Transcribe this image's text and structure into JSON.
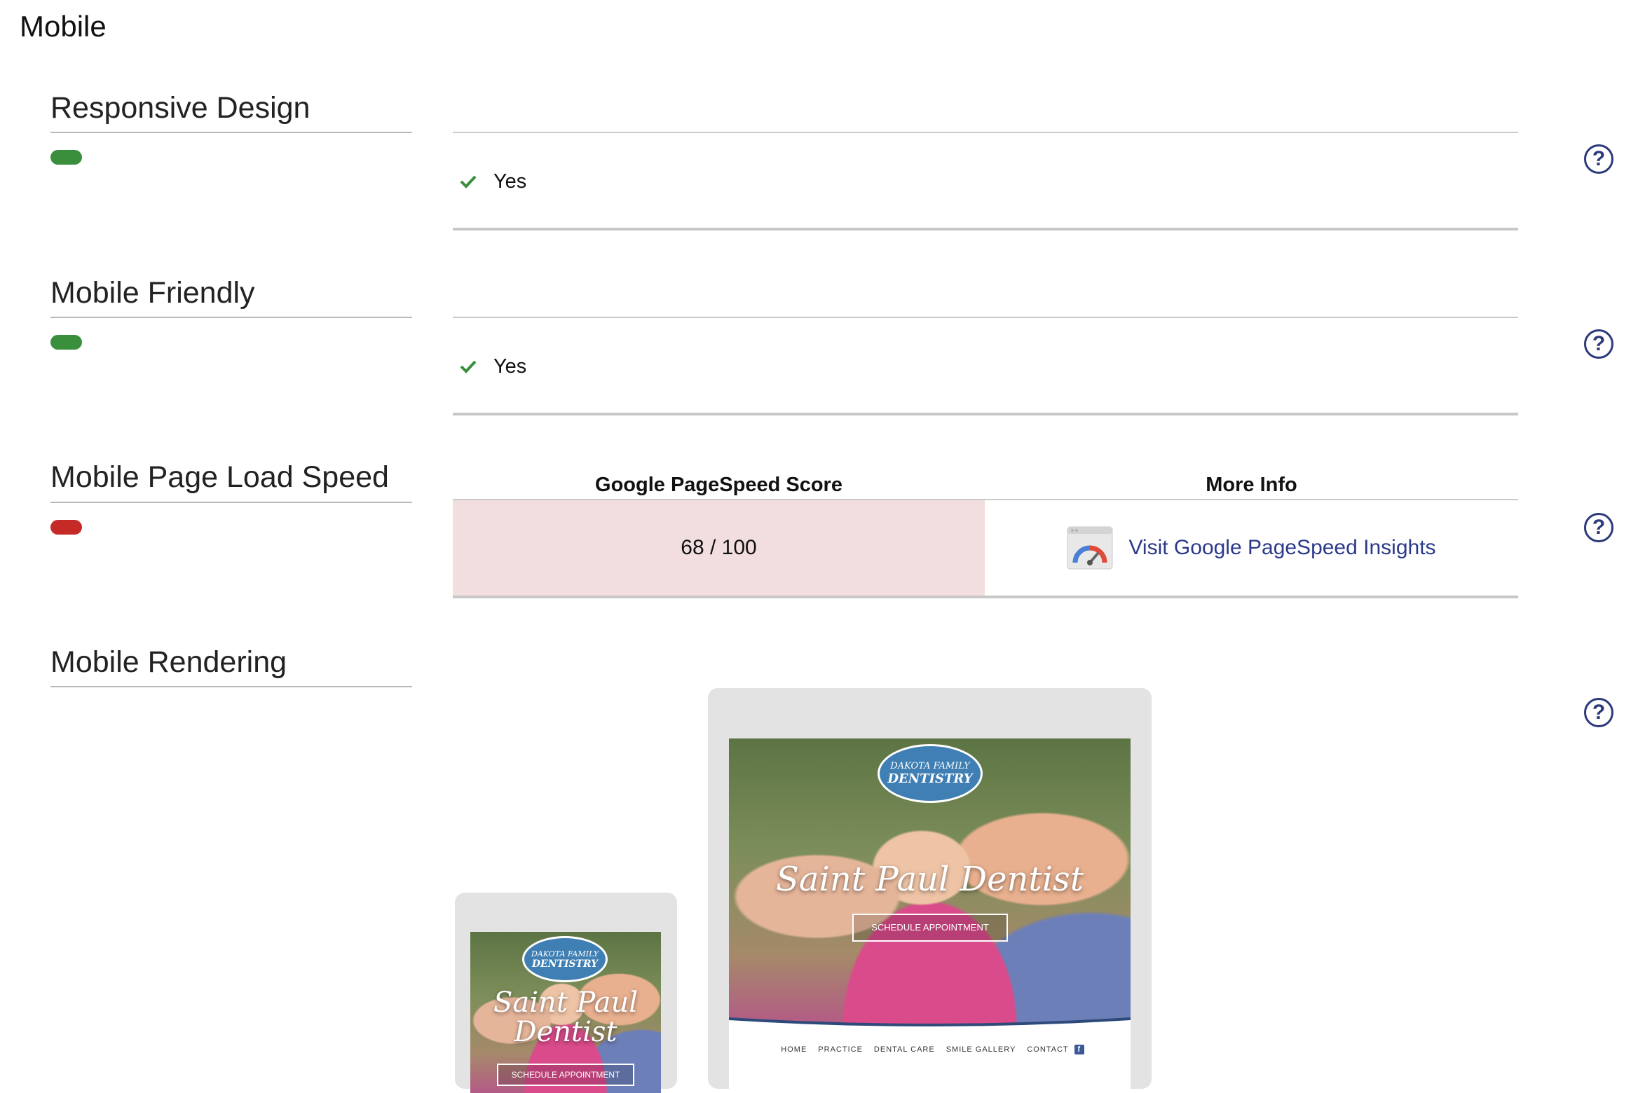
{
  "page_title": "Mobile",
  "sections": [
    {
      "label": "Responsive Design",
      "status": "good",
      "status_color": "#3a8f3c",
      "result": "Yes",
      "help": "?"
    },
    {
      "label": "Mobile Friendly",
      "status": "good",
      "status_color": "#3a8f3c",
      "result": "Yes",
      "help": "?"
    },
    {
      "label": "Mobile Page Load Speed",
      "status": "bad",
      "status_color": "#c62a26",
      "help": "?"
    },
    {
      "label": "Mobile Rendering",
      "help": "?"
    }
  ],
  "pagespeed": {
    "col_score": "Google PageSpeed Score",
    "col_info": "More Info",
    "score": "68 / 100",
    "link_text": "Visit Google PageSpeed Insights",
    "icon": "pagespeed-gauge-icon"
  },
  "rendering": {
    "phone": {
      "logo_top": "DAKOTA FAMILY",
      "logo_bottom": "DENTISTRY",
      "hero_title": "Saint Paul Dentist",
      "button": "SCHEDULE APPOINTMENT"
    },
    "tablet": {
      "logo_top": "DAKOTA FAMILY",
      "logo_bottom": "DENTISTRY",
      "hero_title": "Saint Paul Dentist",
      "button": "SCHEDULE APPOINTMENT",
      "nav": [
        "HOME",
        "PRACTICE",
        "DENTAL CARE",
        "SMILE GALLERY",
        "CONTACT"
      ],
      "nav_icon": "facebook-icon"
    }
  },
  "colors": {
    "good": "#3a8f3c",
    "bad": "#c62a26",
    "score_bg": "#f2dedf",
    "link": "#2b3a8a"
  }
}
